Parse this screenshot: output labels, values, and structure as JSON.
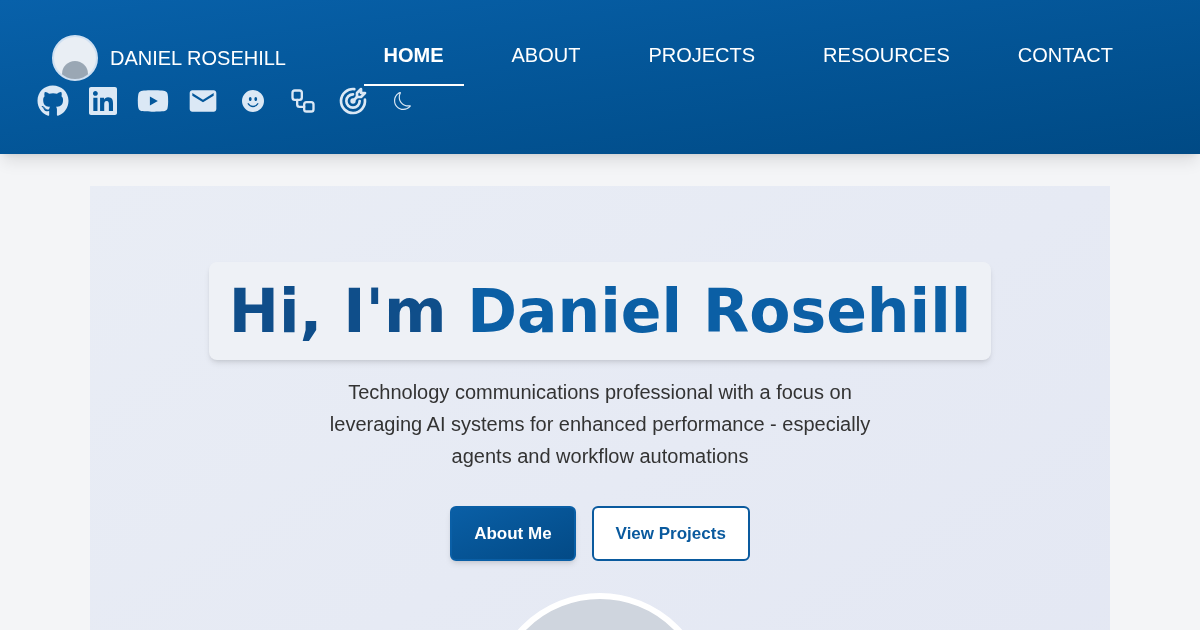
{
  "site_name": "DANIEL ROSEHILL",
  "nav": [
    {
      "label": "HOME",
      "selected": true
    },
    {
      "label": "ABOUT",
      "selected": false
    },
    {
      "label": "PROJECTS",
      "selected": false
    },
    {
      "label": "RESOURCES",
      "selected": false
    },
    {
      "label": "CONTACT",
      "selected": false
    }
  ],
  "hero": {
    "greeting": "Hi, I'm",
    "name": "Daniel Rosehill",
    "tagline": "Technology communications professional with a focus on leveraging AI systems for enhanced performance - especially agents and workflow automations",
    "buttons": [
      {
        "label": "About Me",
        "kind": "primary"
      },
      {
        "label": "View Projects",
        "kind": "outline"
      }
    ]
  }
}
